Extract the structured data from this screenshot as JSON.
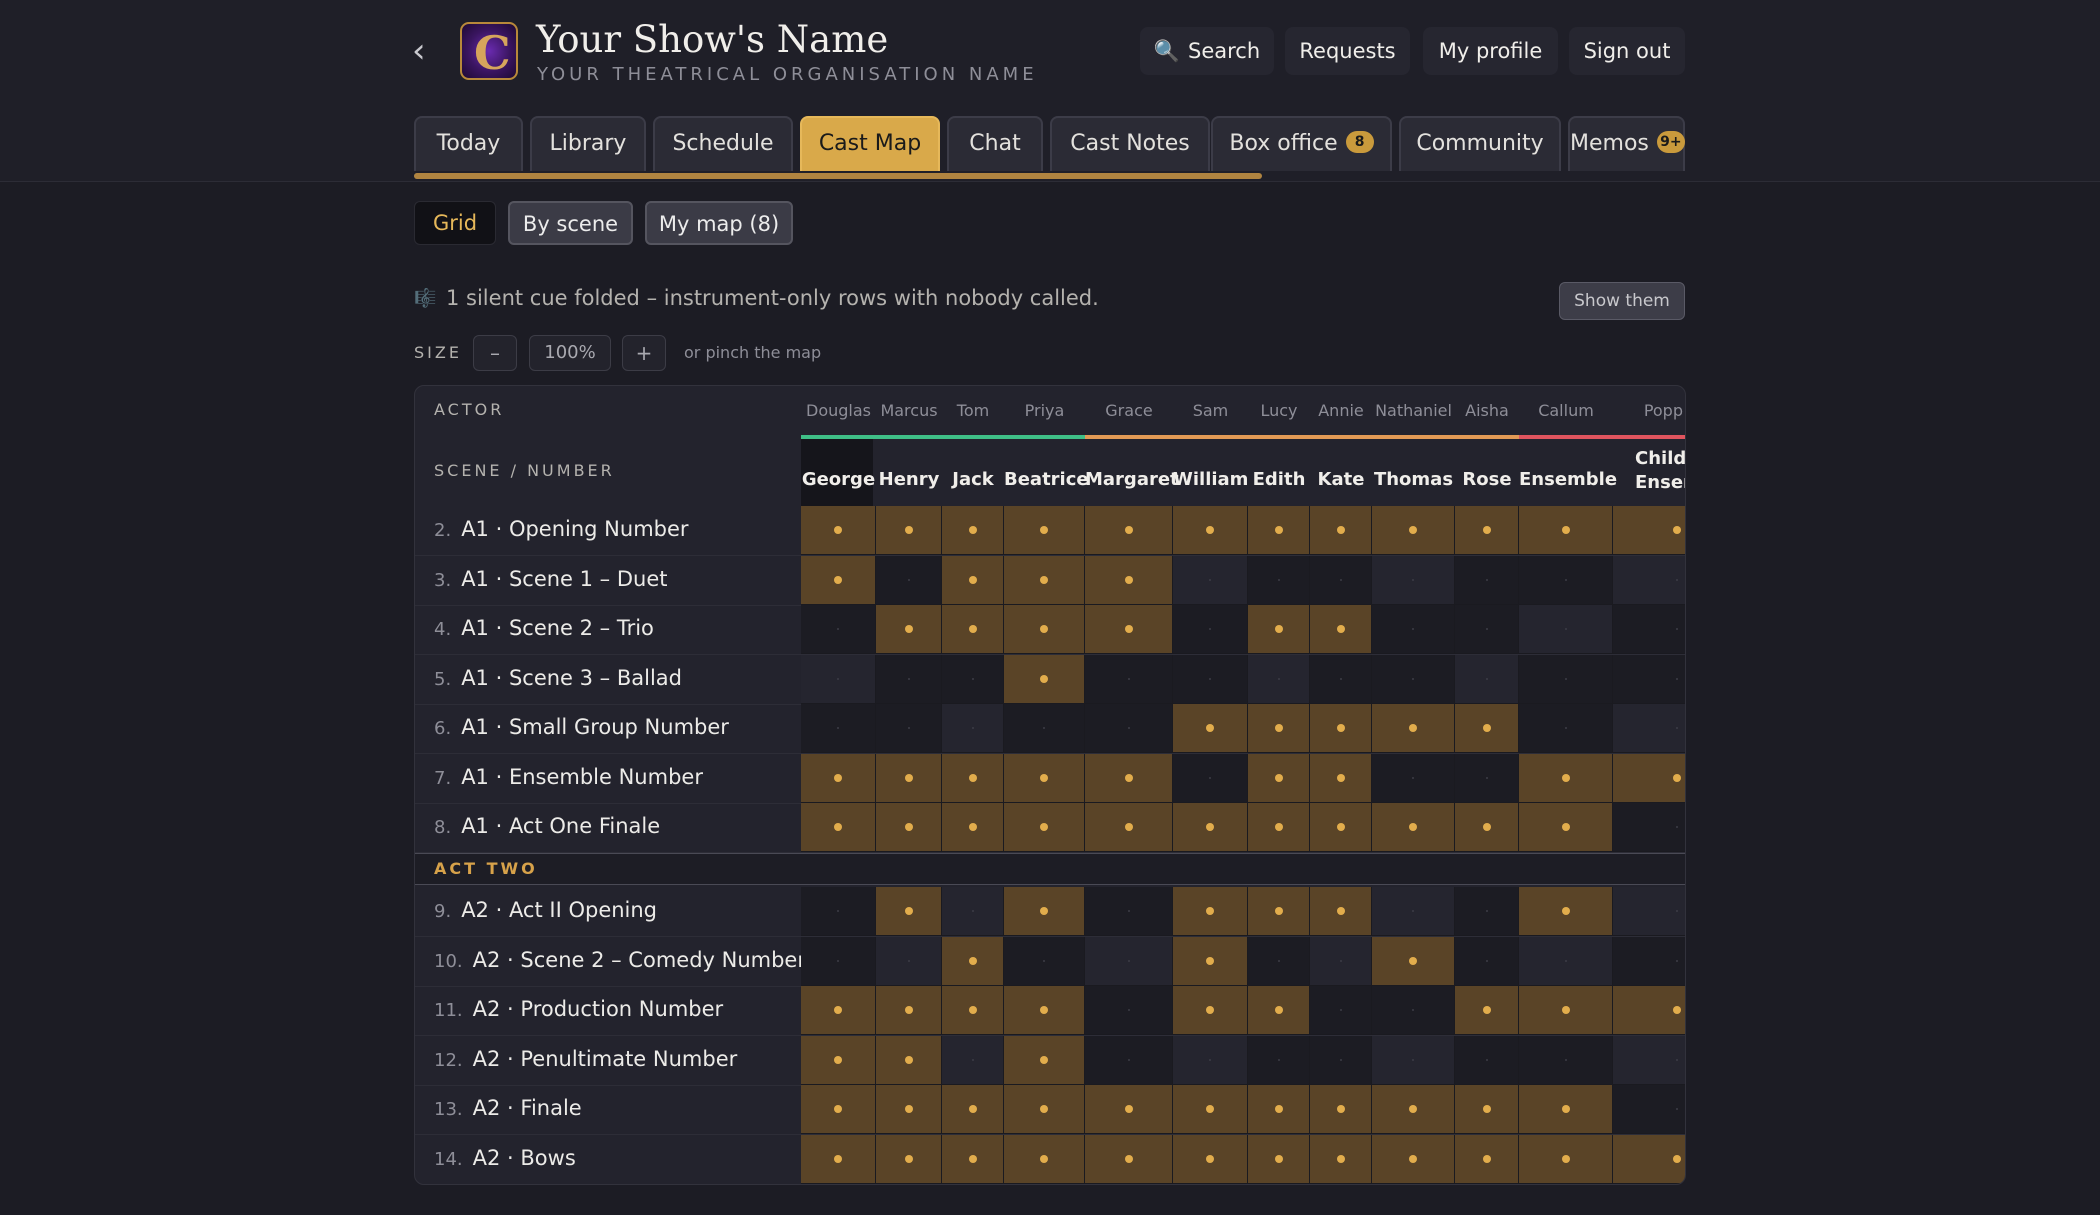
{
  "header": {
    "show_title": "Your Show's Name",
    "org_name": "YOUR THEATRICAL ORGANISATION NAME",
    "logo_letter": "C",
    "buttons": {
      "search": "Search",
      "requests": "Requests",
      "profile": "My profile",
      "signout": "Sign out"
    }
  },
  "tabs": [
    {
      "label": "Today"
    },
    {
      "label": "Library"
    },
    {
      "label": "Schedule"
    },
    {
      "label": "Cast Map",
      "active": true
    },
    {
      "label": "Chat"
    },
    {
      "label": "Cast Notes"
    },
    {
      "label": "Box office",
      "badge": "8"
    },
    {
      "label": "Community"
    },
    {
      "label": "Memos",
      "badge": "9+"
    }
  ],
  "views": {
    "grid": "Grid",
    "by_scene": "By scene",
    "my_map": "My map (8)"
  },
  "notice": {
    "text": "1 silent cue folded – instrument-only rows with nobody called.",
    "action": "Show them"
  },
  "zoom": {
    "label": "SIZE",
    "minus": "–",
    "value": "100%",
    "plus": "+",
    "hint": "or pinch the map"
  },
  "grid": {
    "actor_header": "ACTOR",
    "scene_header": "SCENE / NUMBER",
    "act_two_label": "ACT TWO",
    "columns": [
      {
        "actor": "Douglas",
        "role": "George",
        "color": "#3fbf87"
      },
      {
        "actor": "Marcus",
        "role": "Henry",
        "color": "#3fbf87"
      },
      {
        "actor": "Tom",
        "role": "Jack",
        "color": "#3fbf87"
      },
      {
        "actor": "Priya",
        "role": "Beatrice",
        "color": "#3fbf87"
      },
      {
        "actor": "Grace",
        "role": "Margaret",
        "color": "#e29a55"
      },
      {
        "actor": "Sam",
        "role": "William",
        "color": "#e29a55"
      },
      {
        "actor": "Lucy",
        "role": "Edith",
        "color": "#e29a55"
      },
      {
        "actor": "Annie",
        "role": "Kate",
        "color": "#e29a55"
      },
      {
        "actor": "Nathaniel",
        "role": "Thomas",
        "color": "#e29a55"
      },
      {
        "actor": "Aisha",
        "role": "Rose",
        "color": "#e29a55"
      },
      {
        "actor": "Callum",
        "role": "Ensemble",
        "color": "#e0545e"
      },
      {
        "actor": "Popp",
        "role": "Childr Ensem",
        "color": "#e0545e"
      }
    ],
    "rows": [
      {
        "num": "2.",
        "label": "A1 · Opening Number",
        "cells": "111111111111"
      },
      {
        "num": "3.",
        "label": "A1 · Scene 1 – Duet",
        "cells": "101110000000"
      },
      {
        "num": "4.",
        "label": "A1 · Scene 2 – Trio",
        "cells": "011110110000"
      },
      {
        "num": "5.",
        "label": "A1 · Scene 3 – Ballad",
        "cells": "000100000000"
      },
      {
        "num": "6.",
        "label": "A1 · Small Group Number",
        "cells": "000001111100"
      },
      {
        "num": "7.",
        "label": "A1 · Ensemble Number",
        "cells": "111110110011"
      },
      {
        "num": "8.",
        "label": "A1 · Act One Finale",
        "cells": "111111111110"
      },
      {
        "num": "9.",
        "label": "A2 · Act II Opening",
        "cells": "010101110010"
      },
      {
        "num": "10.",
        "label": "A2 · Scene 2 – Comedy Number",
        "cells": "001001001000"
      },
      {
        "num": "11.",
        "label": "A2 · Production Number",
        "cells": "111101100111"
      },
      {
        "num": "12.",
        "label": "A2 · Penultimate Number",
        "cells": "110100000000"
      },
      {
        "num": "13.",
        "label": "A2 · Finale",
        "cells": "111111111110"
      },
      {
        "num": "14.",
        "label": "A2 · Bows",
        "cells": "111111111111"
      }
    ]
  }
}
